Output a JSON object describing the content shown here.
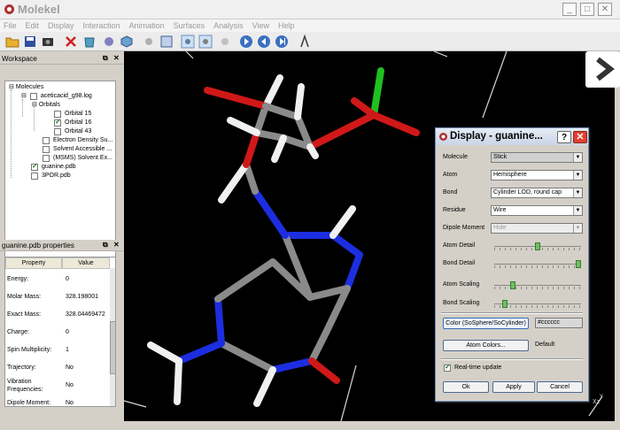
{
  "window": {
    "title": "Molekel",
    "controls": [
      "_",
      "□",
      "✕"
    ]
  },
  "menu": [
    "File",
    "Edit",
    "Display",
    "Interaction",
    "Animation",
    "Surfaces",
    "Analysis",
    "View",
    "Help"
  ],
  "toolbar": {
    "icons": [
      "open-folder-icon",
      "save-icon",
      "camera-icon",
      "delete-icon",
      "recycle-icon",
      "molecule-icon",
      "cube-icon",
      "settings-icon",
      "grid-icon",
      "select-icon",
      "atom-icon",
      "gear-icon",
      "play-icon",
      "rewind-icon",
      "forward-icon",
      "pick-icon"
    ]
  },
  "workspace": {
    "header": "Workspace",
    "ctl_float": "⧉",
    "ctl_close": "✕",
    "tree": {
      "molecules": "Molecules",
      "file1": "aceticacid_g98.log",
      "orbitals": "Orbitals",
      "orb15": "Orbital 15",
      "orb16": "Orbital 16",
      "orb43": "Orbital 43",
      "eds": "Electron Density Su...",
      "sas": "Solvent Accessible ...",
      "msms": "(MSMS) Solvent Ex...",
      "guanine": "guanine.pdb",
      "por": "3POR.pdb"
    }
  },
  "properties": {
    "header": "guanine.pdb properties",
    "col_property": "Property",
    "col_value": "Value",
    "rows": [
      {
        "name": "Energy:",
        "value": "0"
      },
      {
        "name": "Molar Mass:",
        "value": "328.198001"
      },
      {
        "name": "Exact Mass:",
        "value": "328.04469472"
      },
      {
        "name": "Charge:",
        "value": "0"
      },
      {
        "name": "Spin Multiplicity:",
        "value": "1"
      },
      {
        "name": "Trajectory:",
        "value": "No"
      },
      {
        "name": "Vibration Frequencies:",
        "value": "No"
      },
      {
        "name": "Dipole Moment:",
        "value": "No"
      }
    ]
  },
  "dialog": {
    "title": "Display - guanine...",
    "help": "?",
    "close": "✕",
    "molecule_label": "Molecule",
    "molecule_value": "Stick",
    "atom_label": "Atom",
    "atom_value": "Hemisphere",
    "bond_label": "Bond",
    "bond_value": "Cylinder LOD, round cap",
    "residue_label": "Residue",
    "residue_value": "Wire",
    "dipole_label": "Dipole Moment",
    "dipole_value": "Hide",
    "atom_detail_label": "Atom Detail",
    "atom_detail_level": 0.5,
    "bond_detail_label": "Bond Detail",
    "bond_detail_level": 1.0,
    "atom_scaling_label": "Atom Scaling",
    "atom_scaling_level": 0.2,
    "bond_scaling_label": "Bond Scaling",
    "bond_scaling_level": 0.1,
    "color_button": "Color (SoSphere/SoCylinder)",
    "color_value": "#cccccc",
    "atom_colors_button": "Atom Colors...",
    "atom_colors_value": "Default",
    "realtime_label": "Real-time update",
    "ok": "Ok",
    "apply": "Apply",
    "cancel": "Cancel"
  },
  "viewer": {
    "axes_label": "Xz",
    "axes_y": "Y"
  }
}
